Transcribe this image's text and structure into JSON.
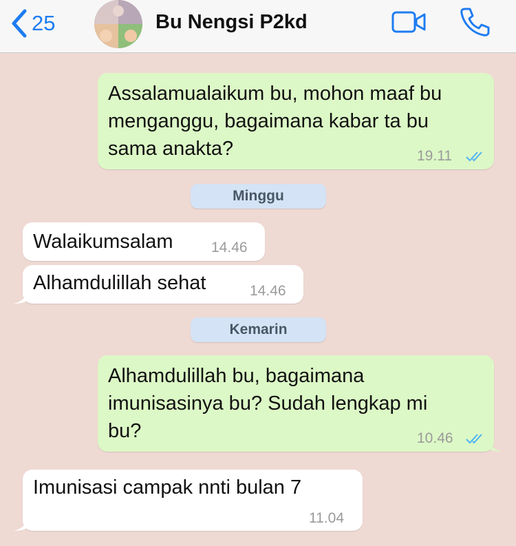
{
  "header": {
    "back_count": "25",
    "contact_name": "Bu Nengsi P2kd"
  },
  "dates": [
    "Minggu",
    "Kemarin"
  ],
  "messages": [
    {
      "direction": "outgoing",
      "lines": [
        "Assalamualaikum bu, mohon maaf bu",
        "menganggu, bagaimana kabar ta bu",
        "sama anakta?"
      ],
      "time": "19.11",
      "read": true
    },
    {
      "direction": "incoming",
      "lines": [
        "Walaikumsalam"
      ],
      "time": "14.46"
    },
    {
      "direction": "incoming",
      "lines": [
        "Alhamdulillah sehat"
      ],
      "time": "14.46"
    },
    {
      "direction": "outgoing",
      "lines": [
        "Alhamdulillah bu, bagaimana",
        "imunisasinya bu? Sudah lengkap mi",
        "bu?"
      ],
      "time": "10.46",
      "read": true
    },
    {
      "direction": "incoming",
      "lines": [
        "Imunisasi campak nnti bulan 7"
      ],
      "time": "11.04"
    }
  ],
  "colors": {
    "background": "#efd9d3",
    "outgoing_bubble": "#dcf8c6",
    "incoming_bubble": "#ffffff",
    "accent": "#1e7cf0",
    "date_pill": "#d4e3f5",
    "read_ticks": "#4fb3f4"
  },
  "icons": {
    "back": "chevron-left-icon",
    "video": "video-camera-icon",
    "call": "phone-icon",
    "read": "double-check-icon"
  }
}
